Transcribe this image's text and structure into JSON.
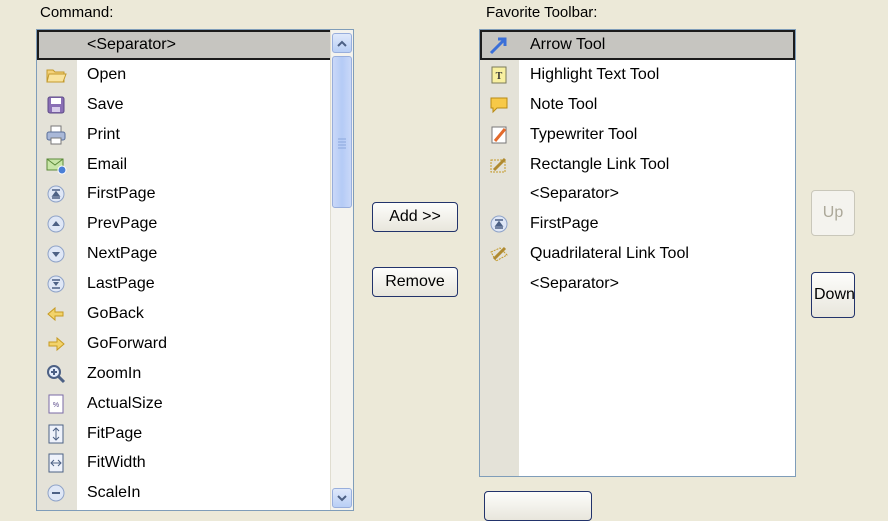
{
  "commands": {
    "label": "Command:",
    "items": [
      {
        "label": "<Separator>",
        "icon": "none",
        "selected": true
      },
      {
        "label": "Open",
        "icon": "folder-open-icon"
      },
      {
        "label": "Save",
        "icon": "save-disk-icon"
      },
      {
        "label": "Print",
        "icon": "printer-icon"
      },
      {
        "label": "Email",
        "icon": "email-icon"
      },
      {
        "label": "FirstPage",
        "icon": "first-page-icon"
      },
      {
        "label": "PrevPage",
        "icon": "prev-page-icon"
      },
      {
        "label": "NextPage",
        "icon": "next-page-icon"
      },
      {
        "label": "LastPage",
        "icon": "last-page-icon"
      },
      {
        "label": "GoBack",
        "icon": "arrow-left-icon"
      },
      {
        "label": "GoForward",
        "icon": "arrow-right-icon"
      },
      {
        "label": "ZoomIn",
        "icon": "zoom-in-icon"
      },
      {
        "label": "ActualSize",
        "icon": "actual-size-icon"
      },
      {
        "label": "FitPage",
        "icon": "fit-page-icon"
      },
      {
        "label": "FitWidth",
        "icon": "fit-width-icon"
      },
      {
        "label": "ScaleIn",
        "icon": "scale-in-icon"
      }
    ]
  },
  "favorites": {
    "label": "Favorite Toolbar:",
    "items": [
      {
        "label": "Arrow Tool",
        "icon": "arrow-tool-icon",
        "selected": true
      },
      {
        "label": "Highlight Text Tool",
        "icon": "highlight-text-icon"
      },
      {
        "label": "Note Tool",
        "icon": "note-icon"
      },
      {
        "label": "Typewriter Tool",
        "icon": "typewriter-icon"
      },
      {
        "label": "Rectangle Link Tool",
        "icon": "rectangle-link-icon"
      },
      {
        "label": "<Separator>",
        "icon": "none"
      },
      {
        "label": "FirstPage",
        "icon": "first-page-icon"
      },
      {
        "label": "Quadrilateral Link Tool",
        "icon": "quadrilateral-link-icon"
      },
      {
        "label": "<Separator>",
        "icon": "none"
      }
    ]
  },
  "buttons": {
    "add": "Add >>",
    "remove": "Remove",
    "up": "Up",
    "down": "Down"
  },
  "colors": {
    "dialog_bg": "#ece9d8",
    "list_border": "#7f9db9",
    "gutter": "#e4e2d8",
    "selected_bg": "#c6c5c0"
  }
}
